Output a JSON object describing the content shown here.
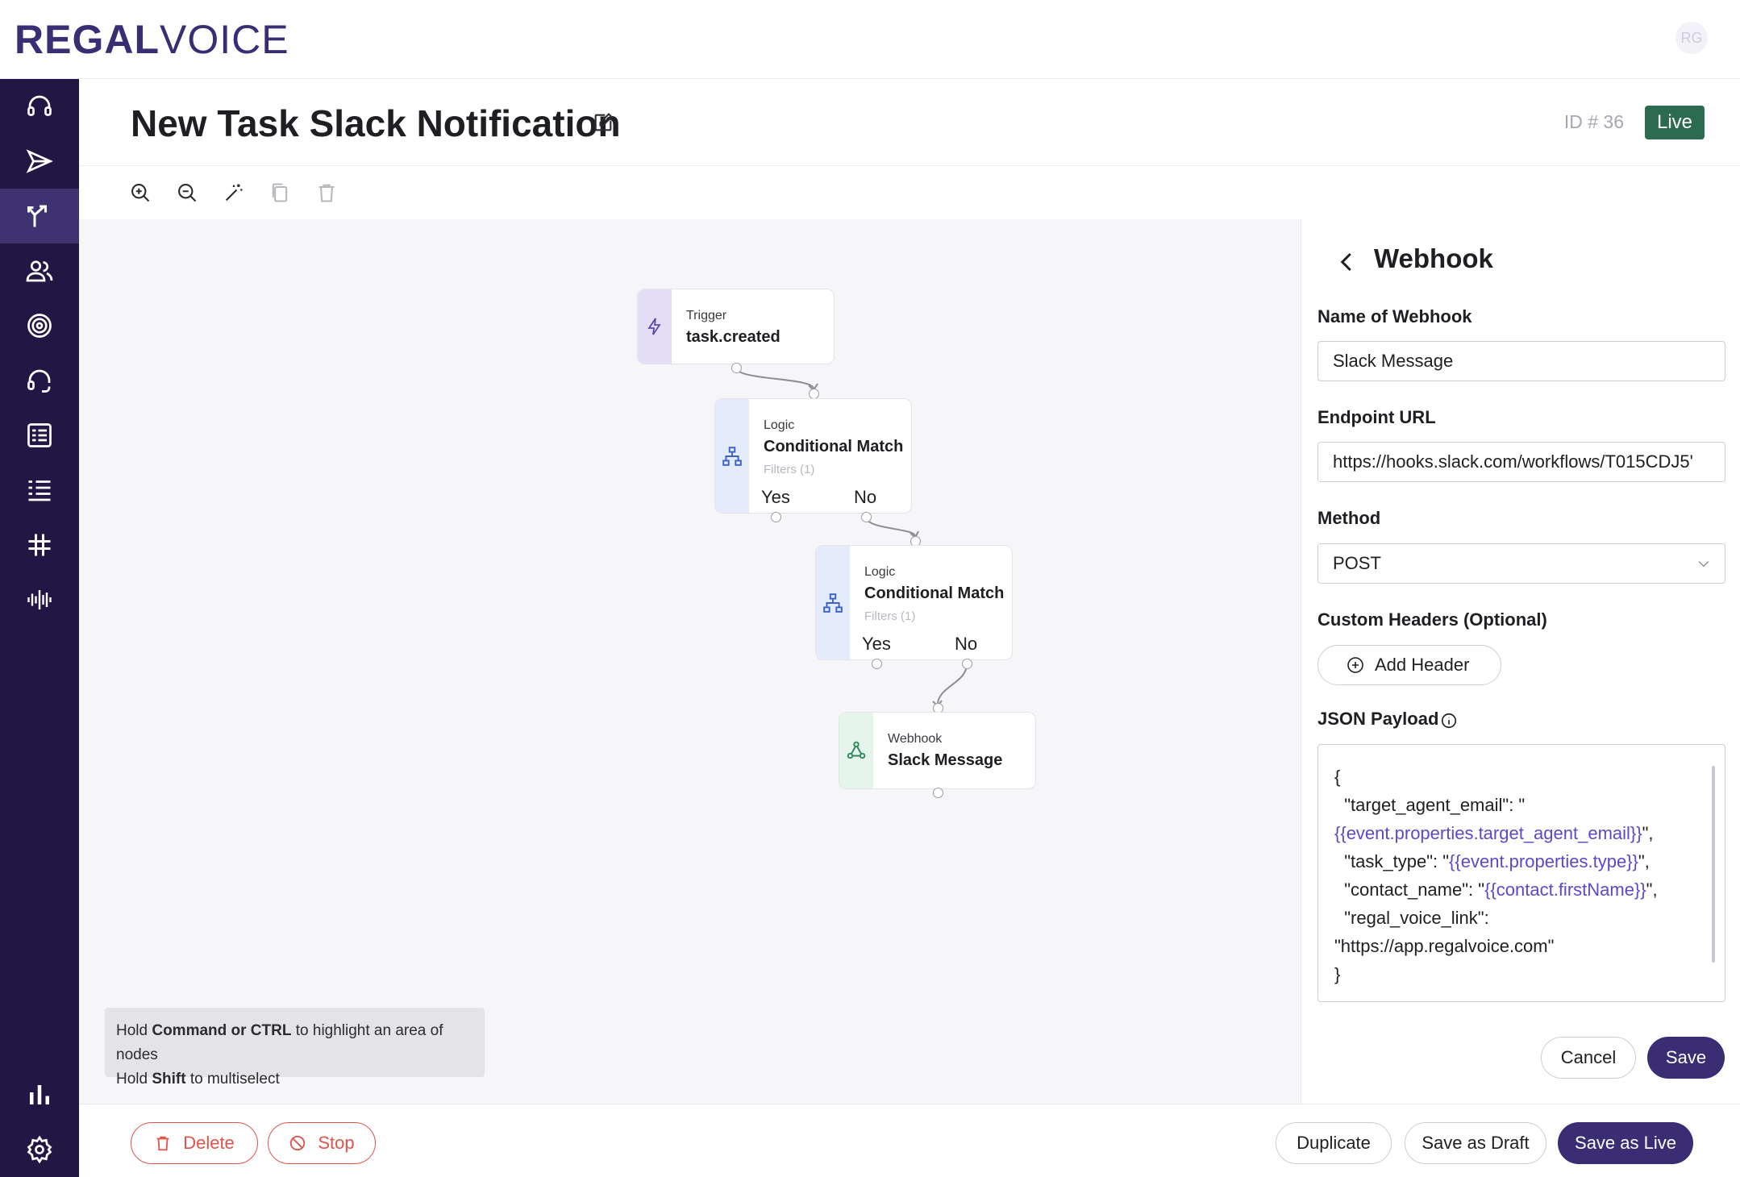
{
  "app": {
    "logo_bold": "REGAL",
    "logo_light": "VOICE",
    "avatar_initials": "RG"
  },
  "sidebar": {
    "items": [
      {
        "icon": "headset-icon"
      },
      {
        "icon": "send-icon"
      },
      {
        "icon": "journey-icon",
        "active": true
      },
      {
        "icon": "contacts-icon"
      },
      {
        "icon": "target-icon"
      },
      {
        "icon": "agent-icon"
      },
      {
        "icon": "forms-icon"
      },
      {
        "icon": "list-icon"
      },
      {
        "icon": "hashtag-icon"
      },
      {
        "icon": "waveform-icon"
      },
      {
        "icon": "analytics-icon"
      },
      {
        "icon": "settings-icon"
      }
    ]
  },
  "header": {
    "title": "New Task Slack Notification",
    "id_label": "ID # 36",
    "status": "Live"
  },
  "toolbar": {
    "tools": [
      "zoom-in-icon",
      "zoom-out-icon",
      "magic-wand-icon",
      "copy-icon",
      "trash-icon"
    ]
  },
  "canvas": {
    "nodes": [
      {
        "type": "Trigger",
        "name": "task.created"
      },
      {
        "type": "Logic",
        "name": "Conditional Match",
        "filters": "Filters (1)",
        "yes": "Yes",
        "no": "No"
      },
      {
        "type": "Logic",
        "name": "Conditional Match",
        "filters": "Filters (1)",
        "yes": "Yes",
        "no": "No"
      },
      {
        "type": "Webhook",
        "name": "Slack Message"
      }
    ],
    "hint": {
      "line1_pre": "Hold ",
      "line1_bold": "Command or CTRL",
      "line1_post": " to highlight an area of nodes",
      "line2_pre": "Hold ",
      "line2_bold": "Shift",
      "line2_post": " to multiselect"
    }
  },
  "panel": {
    "title": "Webhook",
    "name_label": "Name of Webhook",
    "name_value": "Slack Message",
    "url_label": "Endpoint URL",
    "url_value": "https://hooks.slack.com/workflows/T015CDJ5'",
    "method_label": "Method",
    "method_value": "POST",
    "headers_label": "Custom Headers (Optional)",
    "add_header": "Add Header",
    "payload_label": "JSON Payload",
    "json": {
      "l1": "{",
      "l2": "  \"target_agent_email\": \"",
      "l3_var": "{{event.properties.target_agent_email}}",
      "l3_end": "\",",
      "l4_pre": "  \"task_type\": \"",
      "l4_var": "{{event.properties.type}}",
      "l4_end": "\",",
      "l5_pre": "  \"contact_name\": \"",
      "l5_var": "{{contact.firstName}}",
      "l5_end": "\",",
      "l6": "  \"regal_voice_link\":",
      "l7": "\"https://app.regalvoice.com\"",
      "l8": "}"
    },
    "cancel": "Cancel",
    "save": "Save"
  },
  "footer": {
    "delete": "Delete",
    "stop": "Stop",
    "duplicate": "Duplicate",
    "save_draft": "Save as Draft",
    "save_live": "Save as Live"
  },
  "colors": {
    "brand": "#3a2d73",
    "sidebar": "#221645",
    "live": "#2d6b4f",
    "danger": "#e0534b",
    "link_var": "#5b49c9"
  }
}
